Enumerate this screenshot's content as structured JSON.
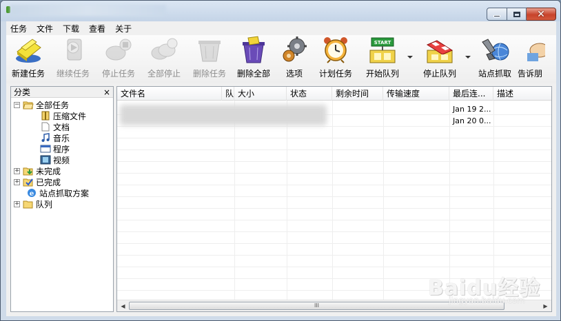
{
  "colors": {
    "close_button": "#c7432b",
    "title_bar": "#c4d4e7",
    "window_bg": "#cfdbe9"
  },
  "menu": [
    "任务",
    "文件",
    "下载",
    "查看",
    "关于"
  ],
  "toolbar": [
    {
      "label": "新建任务",
      "icon": "new-task-icon",
      "enabled": true
    },
    {
      "label": "继续任务",
      "icon": "resume-task-icon",
      "enabled": false
    },
    {
      "label": "停止任务",
      "icon": "stop-task-icon",
      "enabled": false
    },
    {
      "label": "全部停止",
      "icon": "stop-all-icon",
      "enabled": false
    },
    {
      "label": "删除任务",
      "icon": "delete-task-icon",
      "enabled": false
    },
    {
      "label": "删除全部",
      "icon": "delete-all-icon",
      "enabled": true
    },
    {
      "label": "选项",
      "icon": "options-icon",
      "enabled": true
    },
    {
      "label": "计划任务",
      "icon": "schedule-icon",
      "enabled": true
    },
    {
      "label": "开始队列",
      "icon": "start-queue-icon",
      "enabled": true,
      "dropdown": true
    },
    {
      "label": "停止队列",
      "icon": "stop-queue-icon",
      "enabled": true,
      "dropdown": true
    },
    {
      "label": "站点抓取",
      "icon": "site-grabber-icon",
      "enabled": true
    },
    {
      "label": "告诉朋",
      "icon": "tell-friend-icon",
      "enabled": true
    }
  ],
  "start_queue_badge": "START",
  "category": {
    "title": "分类",
    "close": "×",
    "tree": [
      {
        "label": "全部任务",
        "icon": "folder-open-icon",
        "expander": "−"
      },
      {
        "label": "压缩文件",
        "icon": "archive-icon"
      },
      {
        "label": "文档",
        "icon": "document-icon"
      },
      {
        "label": "音乐",
        "icon": "music-note-icon"
      },
      {
        "label": "程序",
        "icon": "program-window-icon"
      },
      {
        "label": "视频",
        "icon": "video-film-icon"
      },
      {
        "label": "未完成",
        "icon": "folder-download-icon",
        "expander": "+"
      },
      {
        "label": "已完成",
        "icon": "folder-check-icon",
        "expander": "+"
      },
      {
        "label": "站点抓取方案",
        "icon": "ie-globe-icon"
      },
      {
        "label": "队列",
        "icon": "folder-queue-icon",
        "expander": "+"
      }
    ]
  },
  "file_list": {
    "columns": [
      "文件名",
      "队",
      "大小",
      "状态",
      "剩余时间",
      "传输速度",
      "最后连...",
      "描述"
    ],
    "rows": [
      {
        "last_connected": "Jan 19 2..."
      },
      {
        "last_connected": "Jan 20 0..."
      }
    ],
    "scroll_thumb": "III",
    "scroll_left": "◀",
    "scroll_right": "▶"
  },
  "watermark": {
    "main": "Baidu经验",
    "sub": "jingyan.baidu.com"
  }
}
